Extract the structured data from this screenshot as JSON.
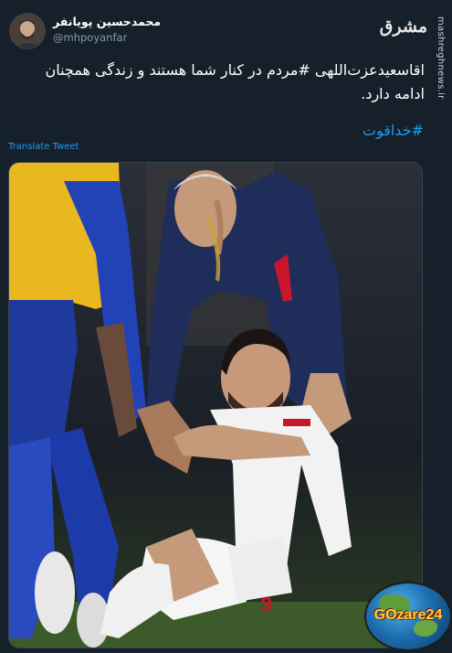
{
  "tweet": {
    "display_name": "محمدحسین پویانفر",
    "handle": "@mhpoyanfar",
    "text": "اقاسعیدعزت‌اللهی #مردم در کنار شما هستند و زندگی همچنان ادامه دارد.",
    "hashtag": "#خداقوت",
    "translate_label": "Translate Tweet"
  },
  "branding": {
    "source_logo": "مشرق",
    "watermark": "mashreghnews.ir",
    "badge_text": "GOzare24"
  },
  "photo": {
    "jersey_number": "9"
  },
  "colors": {
    "background": "#15202b",
    "link": "#1d9bf0",
    "secondary_text": "#8899a6"
  },
  "icons": {
    "avatar": "user-avatar",
    "badge": "globe-icon"
  }
}
